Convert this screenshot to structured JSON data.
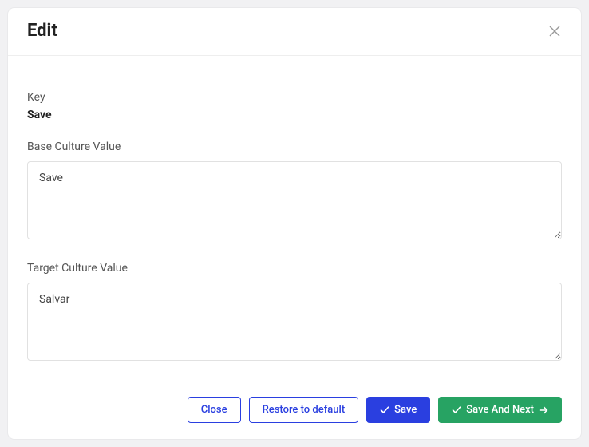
{
  "modal": {
    "title": "Edit",
    "key_label": "Key",
    "key_value": "Save",
    "base_label": "Base Culture Value",
    "base_value": "Save",
    "target_label": "Target Culture Value",
    "target_value": "Salvar"
  },
  "footer": {
    "close": "Close",
    "restore": "Restore to default",
    "save": "Save",
    "save_next": "Save And Next"
  }
}
